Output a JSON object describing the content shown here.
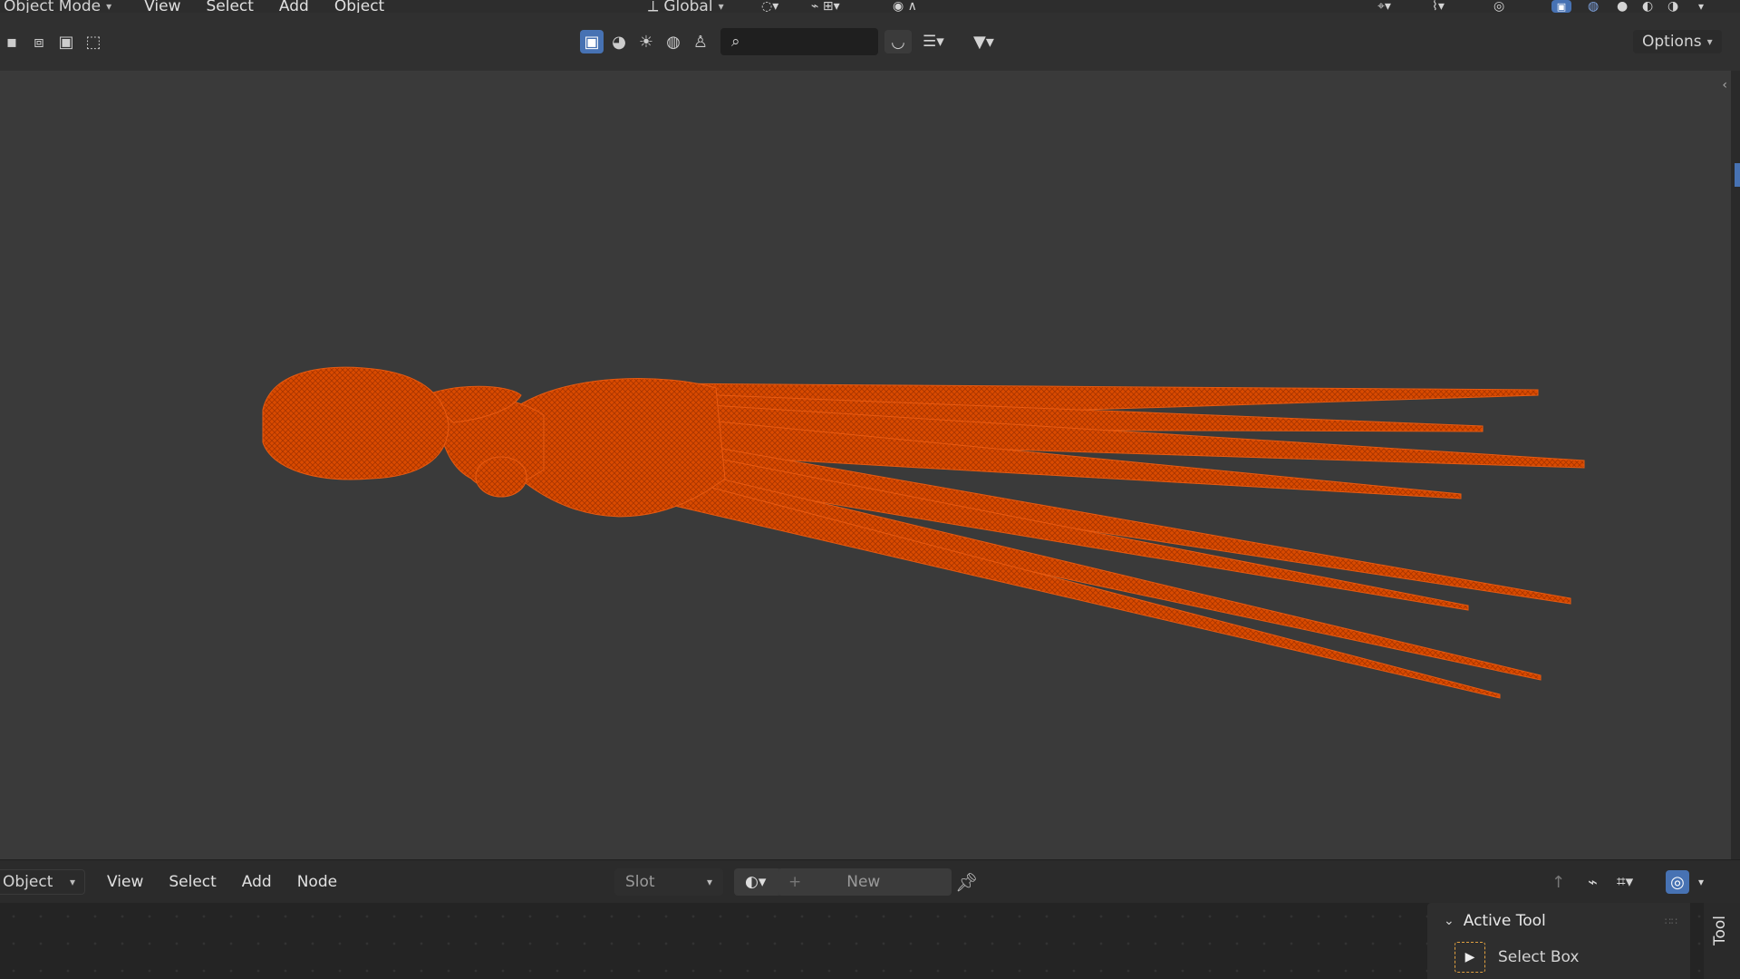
{
  "top_header": {
    "mode_label": "Object Mode",
    "menu": [
      "View",
      "Select",
      "Add",
      "Object"
    ],
    "orientation_label": "Global"
  },
  "tool_header": {
    "options_label": "Options",
    "search_placeholder": ""
  },
  "node_header": {
    "object_label": "Object",
    "menu": [
      "View",
      "Select",
      "Add",
      "Node"
    ],
    "slot_label": "Slot",
    "new_label": "New"
  },
  "side_panel": {
    "section_title": "Active Tool",
    "tool_name": "Select Box",
    "tab_label": "Tool"
  },
  "icons": {
    "mesh_color": "#d94a00",
    "accent": "#4772b3"
  }
}
